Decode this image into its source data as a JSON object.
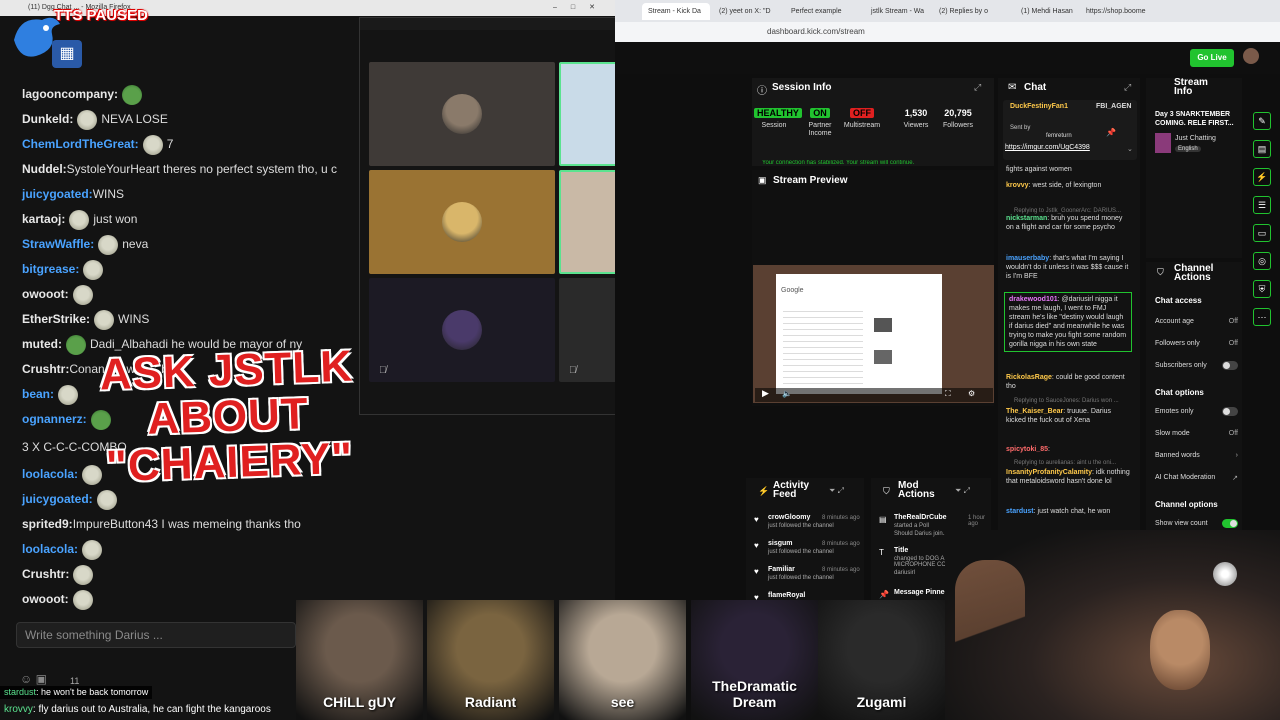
{
  "left_window": {
    "title": "(11) Dgg Chat ... - Mozilla Firefox",
    "tts_badge": "TTS PAUSED",
    "overlay_text": "ASK JSTLK ABOUT \"CHAIERY\"",
    "input_placeholder": "Write something Darius ...",
    "input_count": "11",
    "chat": [
      {
        "user": "lagooncompany:",
        "text": "",
        "color": "#e8e8e8"
      },
      {
        "user": "Dunkeld:",
        "text": "NEVA LOSE",
        "color": "#e8e8e8"
      },
      {
        "user": "ChemLordTheGreat:",
        "text": "7",
        "color": "#4aa3ff"
      },
      {
        "user": "Nuddel:",
        "text": "SystoleYourHeart theres no perfect system tho, u c",
        "color": "#e8e8e8"
      },
      {
        "user": "juicygoated:",
        "text": "WINS",
        "color": "#4aa3ff"
      },
      {
        "user": "kartaoj:",
        "text": "just won",
        "color": "#e8e8e8"
      },
      {
        "user": "StrawWaffle:",
        "text": "neva",
        "color": "#4aa3ff"
      },
      {
        "user": "bitgrease:",
        "text": "",
        "color": "#4aa3ff"
      },
      {
        "user": "owooot:",
        "text": "",
        "color": "#e8e8e8"
      },
      {
        "user": "EtherStrike:",
        "text": "WINS",
        "color": "#e8e8e8"
      },
      {
        "user": "muted:",
        "text": "Dadi_Albahadi he would be mayor of ny",
        "color": "#e8e8e8"
      },
      {
        "user": "Crushtr:",
        "text": "Conan v... with ...bo",
        "color": "#e8e8e8"
      },
      {
        "user": "bean:",
        "text": "",
        "color": "#4aa3ff"
      },
      {
        "user": "ognannerz:",
        "text": "",
        "color": "#4aa3ff"
      },
      {
        "user": "",
        "text": "3 X C-C-C-COMBO",
        "color": "#e8e8e8"
      },
      {
        "user": "loolacola:",
        "text": "",
        "color": "#4aa3ff"
      },
      {
        "user": "juicygoated:",
        "text": "",
        "color": "#4aa3ff"
      },
      {
        "user": "sprited9:",
        "text": "ImpureButton43 I was memeing thanks tho",
        "color": "#e8e8e8"
      },
      {
        "user": "loolacola:",
        "text": "",
        "color": "#4aa3ff"
      },
      {
        "user": "Crushtr:",
        "text": "",
        "color": "#e8e8e8"
      },
      {
        "user": "owooot:",
        "text": "",
        "color": "#e8e8e8"
      }
    ],
    "tts_line1_user": "stardust",
    "tts_line1_text": ": he won't be back tomorrow",
    "tts_line2_user": "krovvy",
    "tts_line2_text": ": fly darius out to Australia, he can fight the kangaroos"
  },
  "call": {
    "tiles": [
      {
        "bg": "#3f3a37",
        "ava": "#8a7a6a"
      },
      {
        "bg": "#c9dbe8",
        "ava": "#3a4a5a",
        "border": "#5be38f"
      },
      {
        "bg": "#9a7333",
        "ava": "#d9b66a"
      },
      {
        "bg": "#c9b9a6",
        "ava": "#e6e0dc",
        "border": "#5be38f"
      },
      {
        "bg": "#1c1a24",
        "ava": "#4a3a6a"
      },
      {
        "bg": "#2a2a2a",
        "ava": "#6a6a6a"
      }
    ]
  },
  "kick": {
    "tabs": [
      {
        "label": "Stream - Kick Da"
      },
      {
        "label": "(2) yeet on X: \"D"
      },
      {
        "label": "Perfect example"
      },
      {
        "label": "jstlk Stream - Wa"
      },
      {
        "label": "(2) Replies by o"
      },
      {
        "label": "(1) Mehdi Hasan"
      },
      {
        "label": "https://shop.boome"
      }
    ],
    "url": "dashboard.kick.com/stream",
    "go_live": "Go Live",
    "session_info": {
      "title": "Session Info",
      "stats": [
        {
          "value": "HEALTHY",
          "label": "Session"
        },
        {
          "value": "ON",
          "label": "Partner Income"
        },
        {
          "value": "OFF",
          "label": "Multistream"
        },
        {
          "value": "1,530",
          "label": "Viewers"
        },
        {
          "value": "20,795",
          "label": "Followers"
        }
      ],
      "notice": "Your connection has stabilized. Your stream will continue."
    },
    "stream_preview": {
      "title": "Stream Preview"
    },
    "chat": {
      "title": "Chat",
      "pinned_user": "DuckFestinyFan1",
      "pinned_user2": "FBI_AGEN",
      "sent_by": "Sent by",
      "sent_user": "femreturn",
      "pinned_link": "https://imgur.com/UgC4398",
      "messages": [
        {
          "user": "",
          "text": "fights against women"
        },
        {
          "user": "krovvy",
          "text": "west side, of lexington"
        },
        {
          "user": "nickstarman",
          "text": "bruh you spend money on a flight and car for some psycho"
        },
        {
          "user": "imauserbaby",
          "text": "that's what I'm saying I wouldn't do it unless it was $$$ cause it is I'm BFE"
        },
        {
          "user": "drakewood101",
          "text": "@dariusirl nigga it makes me laugh, I went to FMJ stream he's like \"destiny would laugh if darius died\" and meanwhile he was trying to make you fight some random gorilla nigga in his own state"
        },
        {
          "user": "RickolasRage",
          "text": "could be good content tho"
        },
        {
          "user": "The_Kaiser_Bear",
          "text": "truuue. Darius kicked the fuck out of Xena"
        },
        {
          "user": "spicytoki_85",
          "text": ""
        },
        {
          "user": "InsanityProfanityCalamity",
          "text": "idk nothing that metaloidsword hasn't done lol"
        },
        {
          "user": "stardust",
          "text": "just watch chat, he won"
        }
      ],
      "replies": [
        "Replying to Jstlk_GoonerArc: DARIUS...",
        "Replying to SauceJones: Darius won ...",
        "Replying to aurelianas: aint u the oni..."
      ]
    },
    "stream_info": {
      "title": "Stream Info",
      "stream_title": "Day 3 SNARKTEMBER COMING. RELE FIRST...",
      "category": "Just Chatting",
      "language": "English"
    },
    "channel_actions": {
      "title": "Channel Actions",
      "chat_access": "Chat access",
      "account_age": {
        "label": "Account age",
        "value": "Off"
      },
      "followers_only": {
        "label": "Followers only",
        "value": "Off"
      },
      "subscribers_only": {
        "label": "Subscribers only"
      },
      "chat_options": "Chat options",
      "emotes_only": {
        "label": "Emotes only"
      },
      "slow_mode": {
        "label": "Slow mode",
        "value": "Off"
      },
      "banned_words": {
        "label": "Banned words"
      },
      "ai_moderation": {
        "label": "AI Chat Moderation"
      },
      "channel_options": "Channel options",
      "show_view_count": {
        "label": "Show view count"
      }
    },
    "activity_feed": {
      "title": "Activity Feed",
      "items": [
        {
          "user": "crowGloomy",
          "sub": "just followed the channel",
          "time": "8 minutes ago"
        },
        {
          "user": "sisgum",
          "sub": "just followed the channel",
          "time": "8 minutes ago"
        },
        {
          "user": "Familiar",
          "sub": "just followed the channel",
          "time": "8 minutes ago"
        },
        {
          "user": "flameRoyal",
          "sub": "",
          "time": ""
        }
      ]
    },
    "mod_actions": {
      "title": "Mod Actions",
      "items": [
        {
          "user": "TheRealDrCube",
          "sub": "started a Poll",
          "extra": "Should Darius join...",
          "time": "1 hour ago"
        },
        {
          "user": "Title",
          "sub": "changed to DOG A... MICROPHONE CO...",
          "extra": "dariusirl",
          "time": ""
        },
        {
          "user": "Message Pinned",
          "sub": "",
          "extra": "",
          "time": ""
        }
      ]
    }
  },
  "filmstrip": [
    {
      "label": "CHiLL gUY",
      "bg": "#6b5a4c"
    },
    {
      "label": "Radiant",
      "bg": "#7a6440"
    },
    {
      "label": "see",
      "bg": "#b8a895"
    },
    {
      "label": "TheDramatic Dream",
      "bg": "#2a2236"
    },
    {
      "label": "Zugami",
      "bg": "#2a2a2a"
    }
  ]
}
